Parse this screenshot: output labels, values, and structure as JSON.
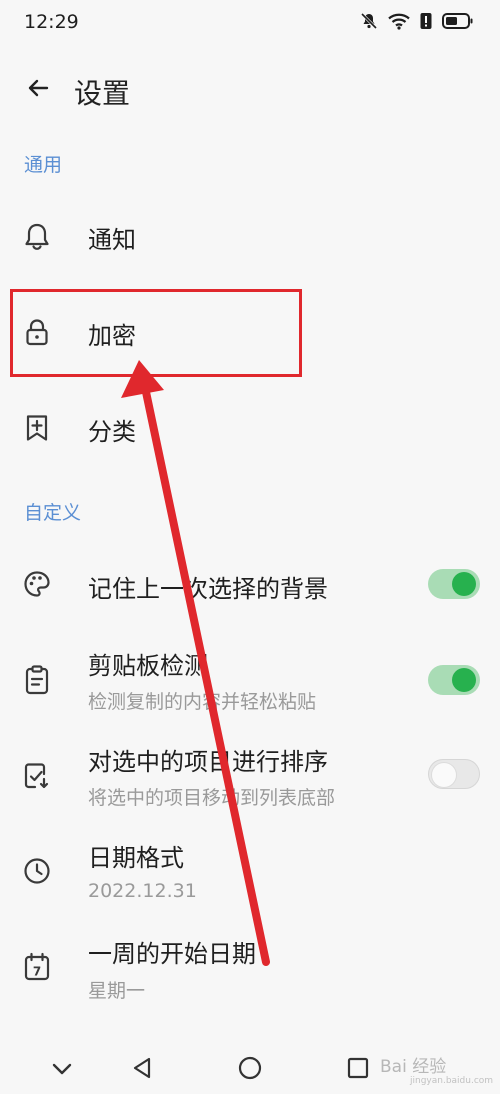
{
  "status_bar": {
    "time": "12:29",
    "icons": [
      "mute-icon",
      "wifi-icon",
      "alert-icon",
      "battery-icon"
    ]
  },
  "header": {
    "title": "设置",
    "back_icon": "arrow-left-icon"
  },
  "sections": {
    "general": "通用",
    "custom": "自定义"
  },
  "general_items": [
    {
      "label": "通知",
      "icon": "bell-icon"
    },
    {
      "label": "加密",
      "icon": "lock-icon"
    },
    {
      "label": "分类",
      "icon": "bookmark-plus-icon"
    }
  ],
  "custom_items": [
    {
      "label": "记住上一次选择的背景",
      "icon": "palette-icon",
      "toggle": true
    },
    {
      "label": "剪贴板检测",
      "sub": "检测复制的内容并轻松粘贴",
      "icon": "clipboard-icon",
      "toggle": true
    },
    {
      "label": "对选中的项目进行排序",
      "sub": "将选中的项目移动到列表底部",
      "icon": "checklist-icon",
      "toggle": false
    },
    {
      "label": "日期格式",
      "sub": "2022.12.31",
      "icon": "clock-icon"
    },
    {
      "label": "一周的开始日期",
      "sub": "星期一",
      "icon": "calendar-icon",
      "calendar_digit": "7"
    }
  ],
  "annotation": {
    "highlight_color": "#e0282d",
    "arrow_color": "#e0282d"
  },
  "nav_bar": {
    "icons": [
      "chevron-down-icon",
      "back-triangle-icon",
      "home-circle-icon",
      "recents-square-icon"
    ]
  },
  "watermark": {
    "text": "Bai 经验",
    "url": "jingyan.baidu.com"
  },
  "colors": {
    "accent": "#5b8fd3",
    "toggle_on": "#27b14e",
    "background": "#f7f7f7"
  }
}
